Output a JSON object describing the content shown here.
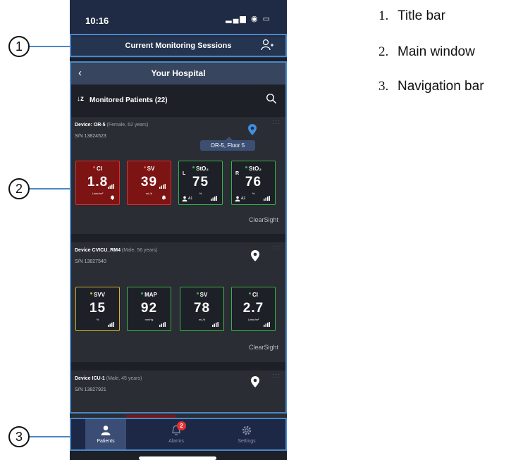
{
  "status_bar": {
    "time": "10:16",
    "signal_icons": "▂▄▆ ◉ ▭"
  },
  "title_bar": {
    "title": "Current Monitoring Sessions",
    "add_user_icon": "add-user-icon"
  },
  "hospital_bar": {
    "back_icon": "chevron-left-icon",
    "title": "Your Hospital"
  },
  "list_header": {
    "sort_icon": "↓z",
    "label": "Monitored Patients (22)",
    "search_icon": "search-icon"
  },
  "devices": [
    {
      "device": "Device: OR-5",
      "info": "(Female, 62 years)",
      "sn": "S/N 13824523",
      "pin_color": "#3d8fe0",
      "tooltip": "OR-5, Floor 5",
      "brand": "ClearSight",
      "params": [
        {
          "name": "CI",
          "value": "1.8",
          "unit": "L/min/m²",
          "status": "alarm"
        },
        {
          "name": "SV",
          "value": "39",
          "unit": "mL/b",
          "status": "alarm"
        },
        {
          "name": "StO₂",
          "side": "L",
          "value": "75",
          "unit": "%",
          "sensor": "A1",
          "status": "normal"
        },
        {
          "name": "StO₂",
          "side": "R",
          "value": "76",
          "unit": "%",
          "sensor": "A2",
          "status": "normal"
        }
      ]
    },
    {
      "device": "Device CVICU_RM4",
      "info": "(Male, 56 years)",
      "sn": "S/N 13827540",
      "pin_color": "#ffffff",
      "brand": "ClearSight",
      "params": [
        {
          "name": "SVV",
          "value": "15",
          "unit": "%",
          "status": "warning"
        },
        {
          "name": "MAP",
          "value": "92",
          "unit": "mmHg",
          "status": "normal"
        },
        {
          "name": "SV",
          "value": "78",
          "unit": "mL/b",
          "status": "normal"
        },
        {
          "name": "CI",
          "value": "2.7",
          "unit": "L/min/m²",
          "status": "normal"
        }
      ]
    },
    {
      "device": "Device ICU-1",
      "info": "(Male, 45 years)",
      "sn": "S/N 13827921",
      "pin_color": "#ffffff"
    }
  ],
  "nav": [
    {
      "label": "Patients",
      "icon": "person-icon",
      "active": true
    },
    {
      "label": "Alarms",
      "icon": "bell-icon",
      "badge": "2"
    },
    {
      "label": "Settings",
      "icon": "gear-icon"
    }
  ],
  "callouts": [
    "1",
    "2",
    "3"
  ],
  "legend": [
    {
      "num": "1.",
      "text": "Title bar"
    },
    {
      "num": "2.",
      "text": "Main window"
    },
    {
      "num": "3.",
      "text": "Navigation bar"
    }
  ],
  "colors": {
    "alarm": "#7d1414",
    "normal_border": "#37b34a",
    "warning_border": "#d4b22c",
    "highlight": "#4a87c8",
    "title_bar": "#25344f"
  }
}
